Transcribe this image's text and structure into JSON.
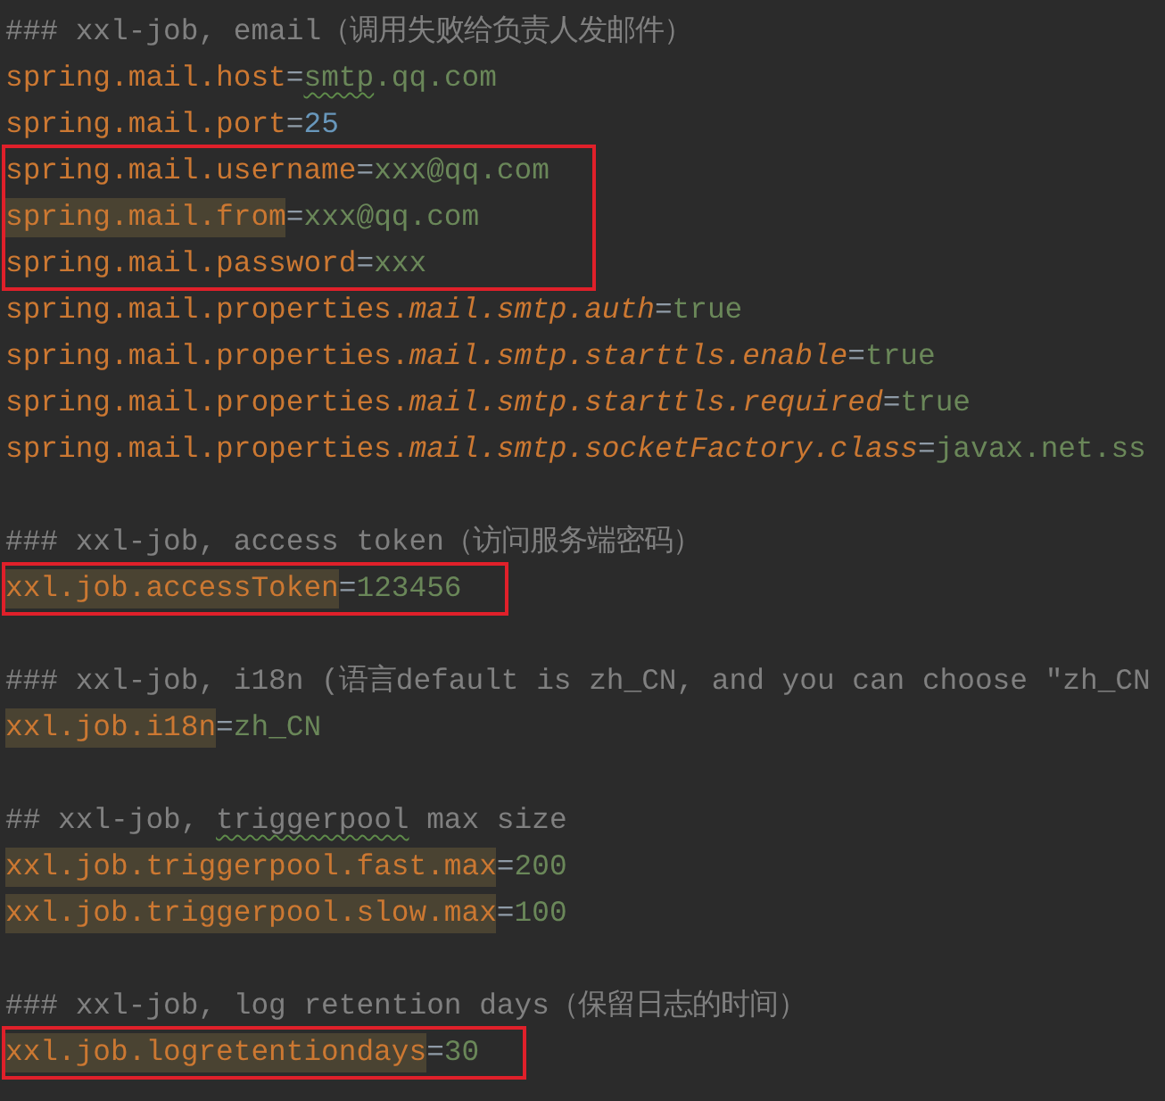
{
  "editor": {
    "lines": [
      {
        "kind": "code",
        "boxed": false,
        "parts": [
          {
            "kind": "comment",
            "text": "### xxl-job, email（调用失败给负责人发邮件）"
          }
        ]
      },
      {
        "kind": "code",
        "boxed": false,
        "parts": [
          {
            "kind": "key",
            "text": "spring.mail.host",
            "highlighted": false
          },
          {
            "kind": "sep",
            "text": "="
          },
          {
            "kind": "value",
            "text": "smtp",
            "typo": true
          },
          {
            "kind": "value",
            "text": ".qq.com"
          }
        ]
      },
      {
        "kind": "code",
        "boxed": false,
        "parts": [
          {
            "kind": "key",
            "text": "spring.mail.port",
            "highlighted": false
          },
          {
            "kind": "sep",
            "text": "="
          },
          {
            "kind": "number",
            "text": "25"
          }
        ]
      },
      {
        "kind": "code",
        "boxed": true,
        "parts": [
          {
            "kind": "key",
            "text": "spring.mail.username",
            "highlighted": false
          },
          {
            "kind": "sep",
            "text": "="
          },
          {
            "kind": "value",
            "text": "xxx@qq.com"
          }
        ]
      },
      {
        "kind": "code",
        "boxed": true,
        "parts": [
          {
            "kind": "key",
            "text": "spring.mail.from",
            "highlighted": true
          },
          {
            "kind": "sep",
            "text": "="
          },
          {
            "kind": "value",
            "text": "xxx@qq.com"
          }
        ]
      },
      {
        "kind": "code",
        "boxed": true,
        "parts": [
          {
            "kind": "key",
            "text": "spring.mail.password",
            "highlighted": false
          },
          {
            "kind": "sep",
            "text": "="
          },
          {
            "kind": "value",
            "text": "xxx"
          }
        ]
      },
      {
        "kind": "code",
        "boxed": false,
        "parts": [
          {
            "kind": "key",
            "text": "spring.mail.properties.*mail.smtp.auth*",
            "highlighted": false
          },
          {
            "kind": "sep",
            "text": "="
          },
          {
            "kind": "value",
            "text": "true"
          }
        ]
      },
      {
        "kind": "code",
        "boxed": false,
        "parts": [
          {
            "kind": "key",
            "text": "spring.mail.properties.*mail.smtp.starttls.enable*",
            "highlighted": false
          },
          {
            "kind": "sep",
            "text": "="
          },
          {
            "kind": "value",
            "text": "true"
          }
        ]
      },
      {
        "kind": "code",
        "boxed": false,
        "parts": [
          {
            "kind": "key",
            "text": "spring.mail.properties.*mail.smtp.starttls.required*",
            "highlighted": false
          },
          {
            "kind": "sep",
            "text": "="
          },
          {
            "kind": "value",
            "text": "true"
          }
        ]
      },
      {
        "kind": "code",
        "boxed": false,
        "parts": [
          {
            "kind": "key",
            "text": "spring.mail.properties.*mail.smtp.socketFactory.class*",
            "highlighted": false
          },
          {
            "kind": "sep",
            "text": "="
          },
          {
            "kind": "value",
            "text": "javax.net.ss"
          }
        ]
      },
      {
        "kind": "blank",
        "boxed": false
      },
      {
        "kind": "code",
        "boxed": false,
        "parts": [
          {
            "kind": "comment",
            "text": "### xxl-job, access token（访问服务端密码）"
          }
        ]
      },
      {
        "kind": "code",
        "boxed": true,
        "parts": [
          {
            "kind": "key",
            "text": "xxl.job.accessToken",
            "highlighted": true
          },
          {
            "kind": "sep",
            "text": "="
          },
          {
            "kind": "value",
            "text": "123456"
          }
        ]
      },
      {
        "kind": "blank",
        "boxed": false
      },
      {
        "kind": "code",
        "boxed": false,
        "parts": [
          {
            "kind": "comment",
            "text": "### xxl-job, i18n (语言default is zh_CN, and you can choose \"zh_CN"
          }
        ]
      },
      {
        "kind": "code",
        "boxed": false,
        "parts": [
          {
            "kind": "key",
            "text": "xxl.job.i18n",
            "highlighted": true
          },
          {
            "kind": "sep",
            "text": "="
          },
          {
            "kind": "value",
            "text": "zh_CN"
          }
        ]
      },
      {
        "kind": "blank",
        "boxed": false
      },
      {
        "kind": "code",
        "boxed": false,
        "parts": [
          {
            "kind": "comment",
            "text": "## xxl-job, "
          },
          {
            "kind": "comment",
            "text": "triggerpool",
            "typo": true
          },
          {
            "kind": "comment",
            "text": " max size"
          }
        ]
      },
      {
        "kind": "code",
        "boxed": false,
        "parts": [
          {
            "kind": "key",
            "text": "xxl.job.triggerpool.fast.max",
            "highlighted": true
          },
          {
            "kind": "sep",
            "text": "="
          },
          {
            "kind": "value",
            "text": "200"
          }
        ]
      },
      {
        "kind": "code",
        "boxed": false,
        "parts": [
          {
            "kind": "key",
            "text": "xxl.job.triggerpool.slow.max",
            "highlighted": true
          },
          {
            "kind": "sep",
            "text": "="
          },
          {
            "kind": "value",
            "text": "100"
          }
        ]
      },
      {
        "kind": "blank",
        "boxed": false
      },
      {
        "kind": "code",
        "boxed": false,
        "parts": [
          {
            "kind": "comment",
            "text": "### xxl-job, log retention days（保留日志的时间）"
          }
        ]
      },
      {
        "kind": "code",
        "boxed": true,
        "parts": [
          {
            "kind": "key",
            "text": "xxl.job.logretentiondays",
            "highlighted": true
          },
          {
            "kind": "sep",
            "text": "="
          },
          {
            "kind": "value",
            "text": "30"
          }
        ]
      }
    ]
  }
}
